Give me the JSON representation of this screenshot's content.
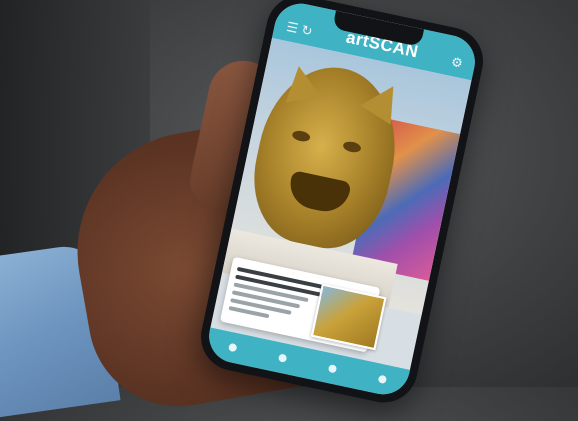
{
  "app": {
    "title": "artSCAN"
  },
  "icons": {
    "menu": "menu-icon",
    "refresh": "refresh-icon",
    "settings": "settings-icon",
    "nav": [
      "home-icon",
      "scan-icon",
      "collection-icon",
      "profile-icon"
    ]
  },
  "colors": {
    "accent": "#3fb2c3",
    "card": "#ffffff"
  }
}
